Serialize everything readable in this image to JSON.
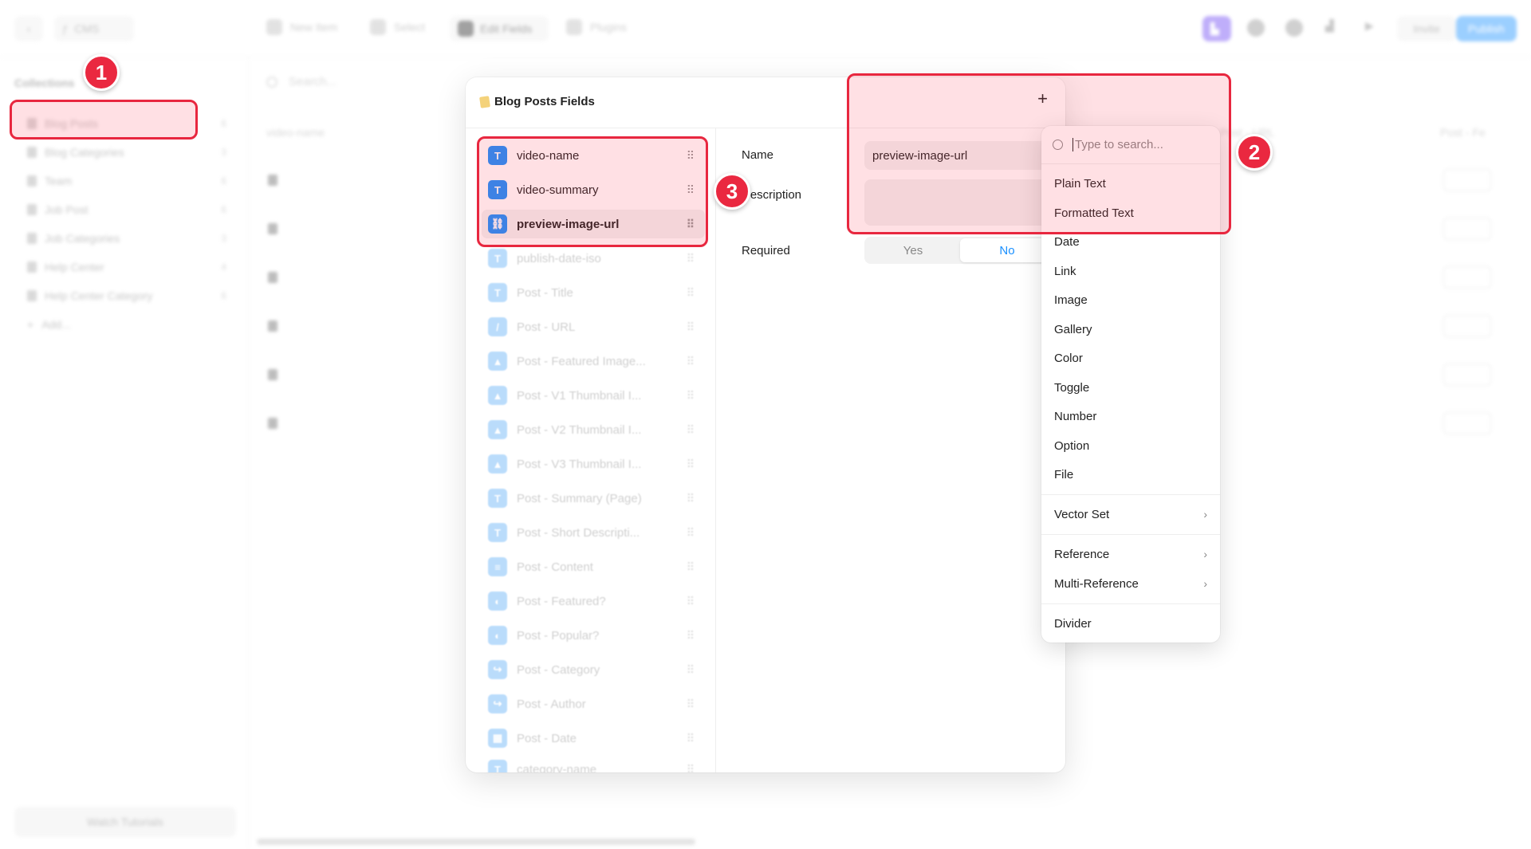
{
  "topbar": {
    "cms_label": "CMS",
    "new_item": "New Item",
    "select": "Select",
    "edit_fields": "Edit Fields",
    "plugins": "Plugins",
    "invite": "Invite",
    "publish": "Publish"
  },
  "sidebar": {
    "title": "Collections",
    "items": [
      {
        "label": "Blog Posts",
        "count": "6"
      },
      {
        "label": "Blog Categories",
        "count": "3"
      },
      {
        "label": "Team",
        "count": "6"
      },
      {
        "label": "Job Post",
        "count": "6"
      },
      {
        "label": "Job Categories",
        "count": "3"
      },
      {
        "label": "Help Center",
        "count": "4"
      },
      {
        "label": "Help Center Category",
        "count": "6"
      }
    ],
    "add_label": "Add...",
    "watch_tutorials": "Watch Tutorials"
  },
  "main": {
    "search_placeholder": "Search...",
    "col1": "video-name",
    "col2": "Post - URL",
    "col3": "Post - Fe"
  },
  "modal": {
    "title": "Blog Posts Fields",
    "plus": "+",
    "fields": [
      {
        "label": "video-name",
        "badge": "T"
      },
      {
        "label": "video-summary",
        "badge": "T"
      },
      {
        "label": "preview-image-url",
        "badge": "⛓"
      },
      {
        "label": "publish-date-iso",
        "badge": "T"
      },
      {
        "label": "Post - Title",
        "badge": "T"
      },
      {
        "label": "Post - URL",
        "badge": "/"
      },
      {
        "label": "Post - Featured Image...",
        "badge": "▲"
      },
      {
        "label": "Post - V1 Thumbnail I...",
        "badge": "▲"
      },
      {
        "label": "Post - V2 Thumbnail I...",
        "badge": "▲"
      },
      {
        "label": "Post - V3 Thumbnail I...",
        "badge": "▲"
      },
      {
        "label": "Post - Summary (Page)",
        "badge": "T"
      },
      {
        "label": "Post - Short Descripti...",
        "badge": "T"
      },
      {
        "label": "Post - Content",
        "badge": "≡"
      },
      {
        "label": "Post - Featured?",
        "badge": "◐"
      },
      {
        "label": "Post - Popular?",
        "badge": "◐"
      },
      {
        "label": "Post - Category",
        "badge": "↪"
      },
      {
        "label": "Post - Author",
        "badge": "↪"
      },
      {
        "label": "Post - Date",
        "badge": "▦"
      },
      {
        "label": "category-name",
        "badge": "T"
      }
    ],
    "detail": {
      "name_label": "Name",
      "name_value": "preview-image-url",
      "description_label": "Description",
      "required_label": "Required",
      "yes": "Yes",
      "no": "No"
    }
  },
  "menu": {
    "search_placeholder": "Type to search...",
    "group1": [
      "Plain Text",
      "Formatted Text",
      "Date",
      "Link",
      "Image",
      "Gallery",
      "Color",
      "Toggle",
      "Number",
      "Option",
      "File"
    ],
    "vector_set": "Vector Set",
    "reference": "Reference",
    "multi_reference": "Multi-Reference",
    "divider": "Divider"
  },
  "annotations": {
    "one": "1",
    "two": "2",
    "three": "3"
  },
  "colors": {
    "accent": "#1a90ff",
    "highlight": "#e8273f",
    "publish": "#4aa8ff"
  }
}
